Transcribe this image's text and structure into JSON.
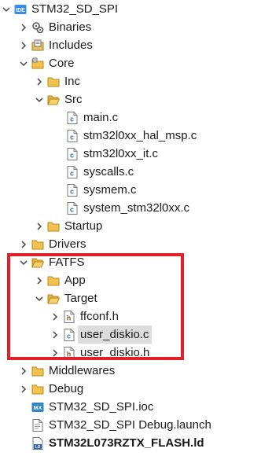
{
  "project": {
    "name": "STM32_SD_SPI",
    "badge": "IDE"
  },
  "tree": {
    "binaries": "Binaries",
    "includes": "Includes",
    "core": "Core",
    "inc": "Inc",
    "src": "Src",
    "src_files": [
      "main.c",
      "stm32l0xx_hal_msp.c",
      "stm32l0xx_it.c",
      "syscalls.c",
      "sysmem.c",
      "system_stm32l0xx.c"
    ],
    "startup": "Startup",
    "drivers": "Drivers",
    "fatfs": "FATFS",
    "app": "App",
    "target": "Target",
    "target_files": [
      "ffconf.h",
      "user_diskio.c",
      "user_diskio.h"
    ],
    "middlewares": "Middlewares",
    "debug": "Debug",
    "ioc_file": "STM32_SD_SPI.ioc",
    "ioc_badge": "MX",
    "launch_file": "STM32_SD_SPI Debug.launch",
    "ld_file": "STM32L073RZTX_FLASH.ld",
    "ld_badge": "LD"
  },
  "colors": {
    "highlight_border": "#e0202a",
    "selection": "#dcdcdc"
  }
}
